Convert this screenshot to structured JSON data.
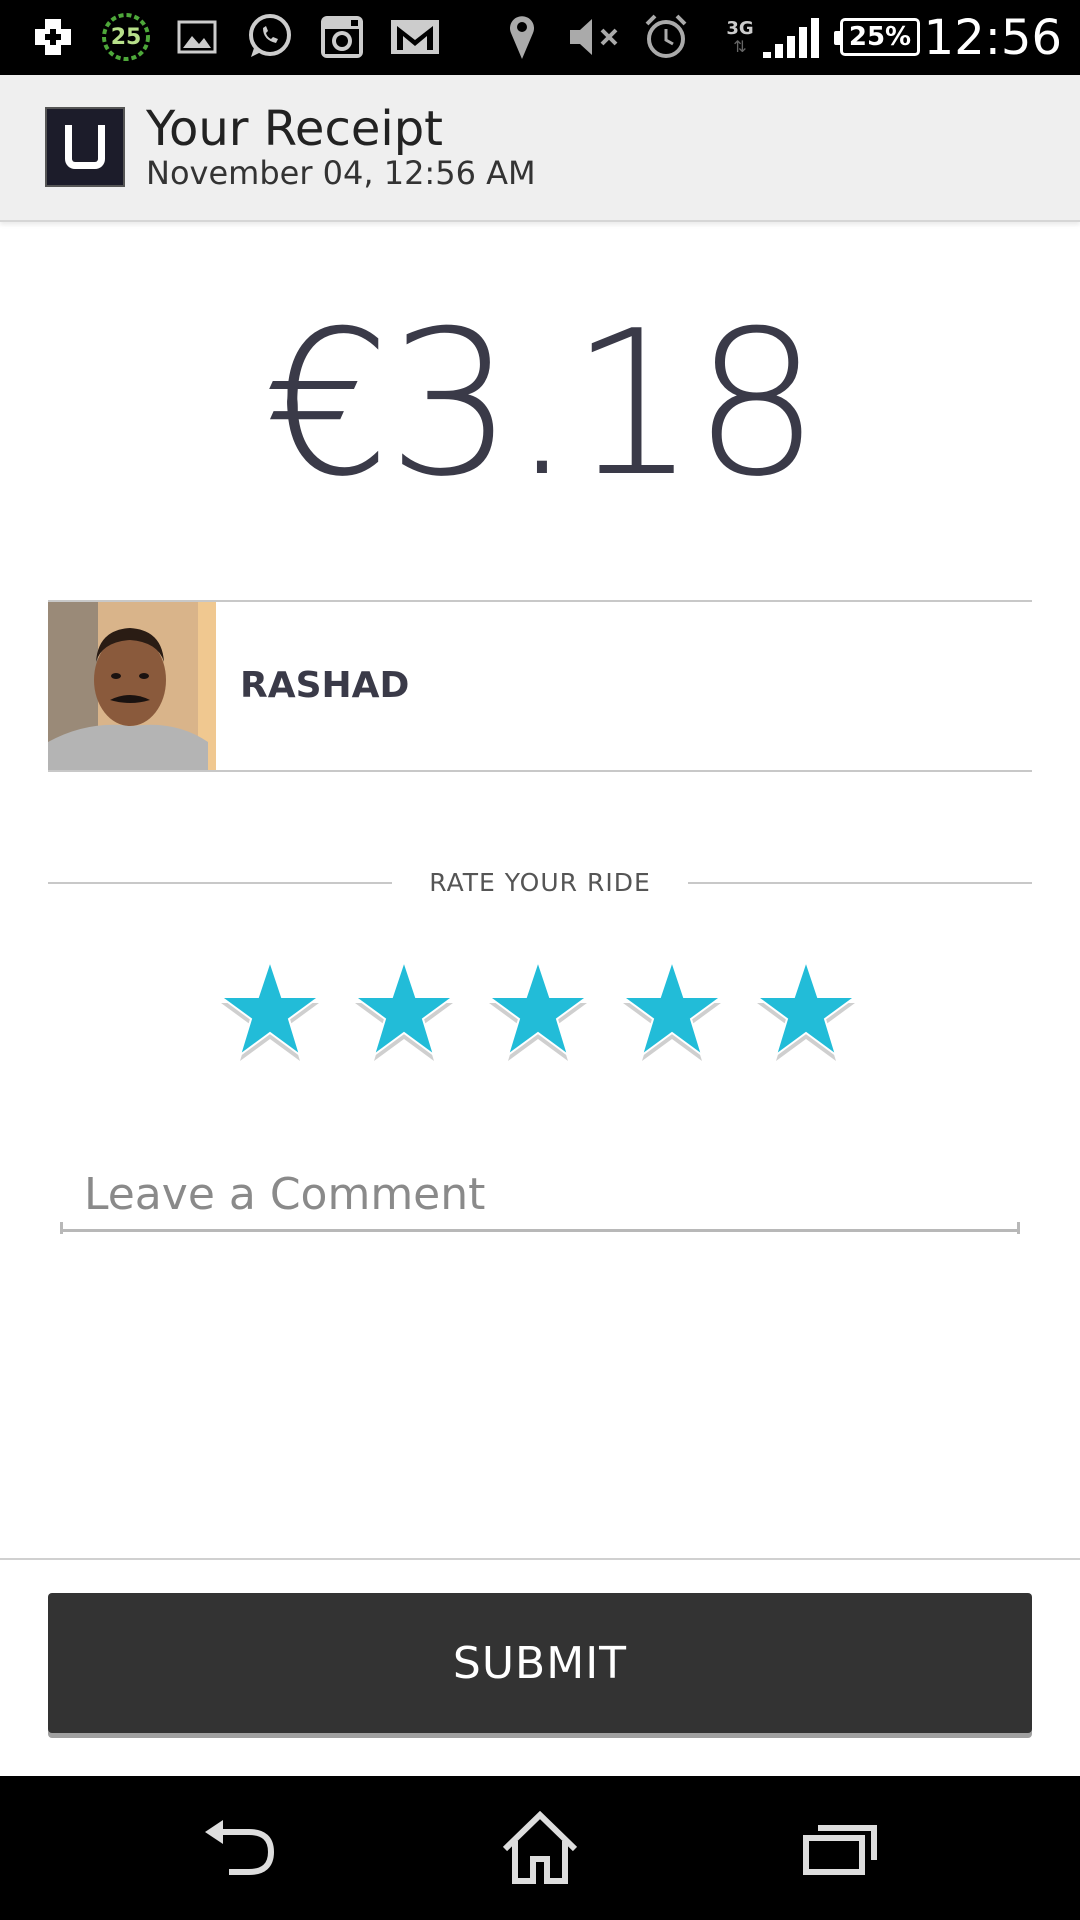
{
  "status_bar": {
    "notification_count": "25",
    "battery": "25%",
    "network": "3G",
    "time": "12:56",
    "icons": [
      "plus-icon",
      "badge-25-icon",
      "gallery-icon",
      "whatsapp-icon",
      "instagram-icon",
      "gmail-icon",
      "location-icon",
      "mute-icon",
      "alarm-icon",
      "signal-icon",
      "battery-icon"
    ]
  },
  "header": {
    "title": "Your Receipt",
    "subtitle": "November 04, 12:56 AM",
    "logo_icon": "uber-u-logo"
  },
  "fare": "€3.18",
  "driver": {
    "name": "RASHAD"
  },
  "rating": {
    "label": "RATE YOUR RIDE",
    "stars_total": 5,
    "stars_selected": 5,
    "star_color": "#22bcd8"
  },
  "comment": {
    "placeholder": "Leave a Comment",
    "value": ""
  },
  "submit_label": "SUBMIT",
  "nav": {
    "icons": [
      "back-icon",
      "home-icon",
      "recent-apps-icon"
    ]
  },
  "colors": {
    "header_bg": "#efefef",
    "fare_text": "#3a3a48",
    "button_bg": "#333333"
  }
}
